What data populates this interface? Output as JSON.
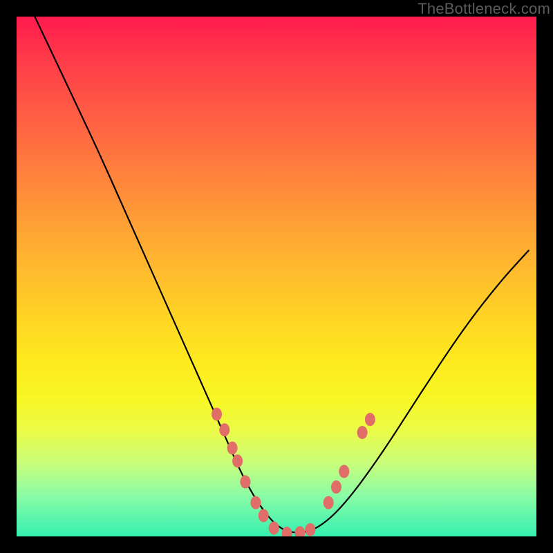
{
  "watermark": "TheBottleneck.com",
  "chart_data": {
    "type": "line",
    "title": "",
    "xlabel": "",
    "ylabel": "",
    "xlim": [
      0,
      1
    ],
    "ylim": [
      0,
      1
    ],
    "series": [
      {
        "name": "curve",
        "x": [
          0.035,
          0.08,
          0.12,
          0.16,
          0.2,
          0.24,
          0.28,
          0.32,
          0.36,
          0.4,
          0.435,
          0.47,
          0.505,
          0.54,
          0.58,
          0.63,
          0.7,
          0.78,
          0.86,
          0.93,
          0.985
        ],
        "y": [
          1.0,
          0.905,
          0.82,
          0.735,
          0.645,
          0.555,
          0.465,
          0.375,
          0.285,
          0.195,
          0.115,
          0.055,
          0.015,
          0.005,
          0.015,
          0.06,
          0.155,
          0.28,
          0.4,
          0.49,
          0.55
        ]
      }
    ],
    "markers": [
      {
        "x": 0.385,
        "y": 0.235
      },
      {
        "x": 0.4,
        "y": 0.205
      },
      {
        "x": 0.415,
        "y": 0.17
      },
      {
        "x": 0.425,
        "y": 0.145
      },
      {
        "x": 0.44,
        "y": 0.105
      },
      {
        "x": 0.46,
        "y": 0.065
      },
      {
        "x": 0.475,
        "y": 0.04
      },
      {
        "x": 0.495,
        "y": 0.016
      },
      {
        "x": 0.52,
        "y": 0.006
      },
      {
        "x": 0.545,
        "y": 0.007
      },
      {
        "x": 0.565,
        "y": 0.013
      },
      {
        "x": 0.6,
        "y": 0.065
      },
      {
        "x": 0.615,
        "y": 0.095
      },
      {
        "x": 0.63,
        "y": 0.125
      },
      {
        "x": 0.665,
        "y": 0.2
      },
      {
        "x": 0.68,
        "y": 0.225
      }
    ],
    "colors": {
      "curve": "#000000",
      "markers": "#e06d67"
    }
  }
}
